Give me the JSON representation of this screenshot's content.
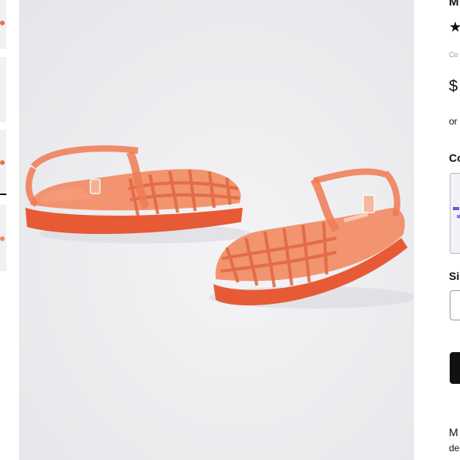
{
  "product": {
    "title": "M",
    "rating_icon": "star-icon",
    "rating_stars": "★",
    "code_text": "Co",
    "price": "$",
    "installments_text": "or",
    "color_label": "Co",
    "size_label": "Si",
    "description_start": "M",
    "description_line2": "de"
  },
  "gallery": {
    "thumbnail_count": 4,
    "selected_index": 2,
    "main_image_alt": "orange jelly fisherman sandals"
  },
  "colors": {
    "sandal": "#f07a52",
    "sole": "#e65a36",
    "accent": "#111111",
    "swatch_accent": "#6b5bd6"
  }
}
